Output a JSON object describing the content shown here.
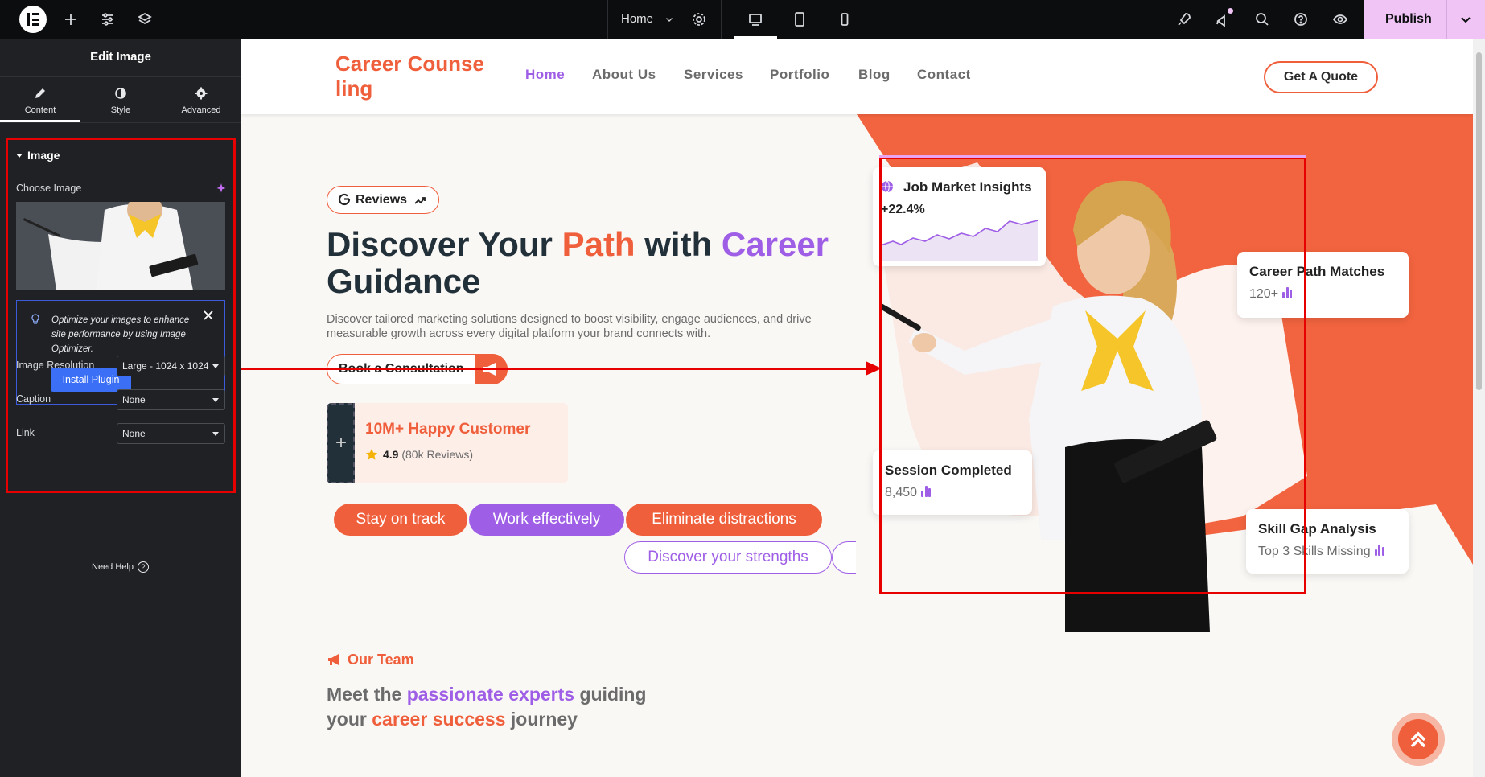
{
  "topbar": {
    "page_selector": "Home",
    "publish_label": "Publish",
    "colors": {
      "bg": "#0c0d0e",
      "publish": "#f0c5f5"
    },
    "icons": [
      "elementor-logo-icon",
      "add-icon",
      "settings-sliders-icon",
      "layers-icon",
      "page-settings-icon",
      "desktop-icon",
      "tablet-icon",
      "mobile-icon",
      "rocket-icon",
      "whats-new-icon",
      "search-icon",
      "help-icon",
      "preview-eye-icon"
    ]
  },
  "panel": {
    "title": "Edit Image",
    "tabs": [
      {
        "label": "Content",
        "icon": "pencil-icon",
        "active": true
      },
      {
        "label": "Style",
        "icon": "contrast-icon",
        "active": false
      },
      {
        "label": "Advanced",
        "icon": "gear-icon",
        "active": false
      }
    ],
    "section_title": "Image",
    "choose_image_label": "Choose Image",
    "notice": {
      "text": "Optimize your images to enhance site performance by using Image Optimizer.",
      "button": "Install Plugin"
    },
    "fields": [
      {
        "label": "Image Resolution",
        "value": "Large - 1024 x 1024"
      },
      {
        "label": "Caption",
        "value": "None"
      },
      {
        "label": "Link",
        "value": "None"
      }
    ],
    "help": "Need Help"
  },
  "site": {
    "brand_line1": "Career Counse",
    "brand_line2": "ling",
    "nav": [
      {
        "label": "Home",
        "active": true
      },
      {
        "label": "About Us",
        "active": false
      },
      {
        "label": "Services",
        "active": false
      },
      {
        "label": "Portfolio",
        "active": false
      },
      {
        "label": "Blog",
        "active": false
      },
      {
        "label": "Contact",
        "active": false
      }
    ],
    "cta": "Get A Quote",
    "colors": {
      "orange": "#ef5f3c",
      "purple": "#9f5ee6",
      "dark": "#22303a"
    }
  },
  "hero": {
    "reviews": "Reviews",
    "title_part1": "Discover Your ",
    "title_path": "Path",
    "title_part2": " with ",
    "title_career": "Career",
    "title_line2": "Guidance",
    "description": "Discover tailored marketing solutions designed to boost visibility, engage audiences, and drive measurable growth across every digital platform your brand connects with.",
    "consult_button": "Book a Consultation",
    "customer_title": "10M+ Happy Customer",
    "rating": "4.9",
    "rating_reviews": "(80k Reviews)",
    "pills": [
      "Stay on track",
      "Work effectively",
      "Eliminate distractions",
      "Discover your strengths"
    ]
  },
  "stats": [
    {
      "title": "Job Market Insights",
      "value": "+22.4%"
    },
    {
      "title": "Career Path Matches",
      "value": "120+"
    },
    {
      "title": "Session Completed",
      "value": "8,450"
    },
    {
      "title": "Skill Gap Analysis",
      "value": "Top 3 Skills Missing"
    }
  ],
  "team": {
    "label": "Our Team",
    "title_part1": "Meet the ",
    "title_hl1": "passionate experts",
    "title_part2": " guiding your ",
    "title_hl2": "career success",
    "title_part3": " journey"
  }
}
